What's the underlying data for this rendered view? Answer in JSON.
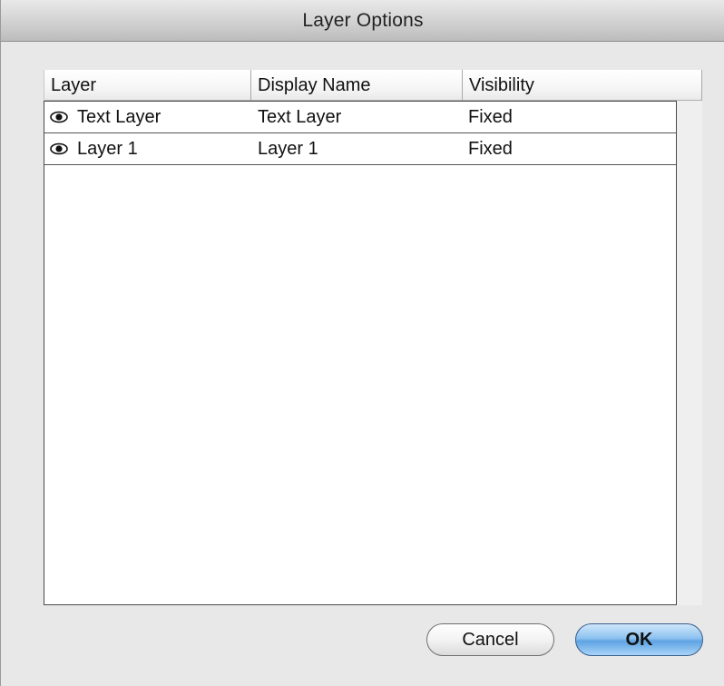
{
  "window": {
    "title": "Layer Options"
  },
  "table": {
    "columns": [
      "Layer",
      "Display Name",
      "Visibility"
    ],
    "rows": [
      {
        "layer": "Text Layer",
        "display_name": "Text Layer",
        "visibility": "Fixed",
        "icon": "eye-icon"
      },
      {
        "layer": "Layer 1",
        "display_name": "Layer 1",
        "visibility": "Fixed",
        "icon": "eye-icon"
      }
    ]
  },
  "buttons": {
    "cancel_label": "Cancel",
    "ok_label": "OK"
  },
  "colors": {
    "ok_button_accent": "#5fa3e3",
    "window_background": "#e8e8e8"
  }
}
